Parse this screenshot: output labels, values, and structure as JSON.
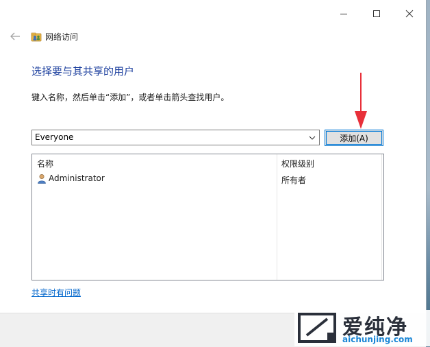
{
  "window": {
    "title": "网络访问"
  },
  "header": {
    "heading": "选择要与其共享的用户",
    "instruction": "键入名称，然后单击“添加”，或者单击箭头查找用户。"
  },
  "user_input": {
    "value": "Everyone"
  },
  "add_button": {
    "label": "添加(A)"
  },
  "table": {
    "columns": [
      "名称",
      "权限级别"
    ],
    "rows": [
      {
        "name": "Administrator",
        "permission": "所有者"
      }
    ]
  },
  "help_link": {
    "label": "共享时有问题"
  },
  "watermark": {
    "title": "爱纯净",
    "url": "aichunjing.com"
  },
  "colors": {
    "heading": "#1c3f9e",
    "link": "#0066cc",
    "accent": "#0078d7",
    "annotation_arrow": "#e8303a"
  },
  "icons": {
    "back": "arrow-left-icon",
    "app": "network-share-icon",
    "user": "user-icon",
    "dropdown": "chevron-down-icon",
    "minimize": "minimize-icon",
    "maximize": "maximize-icon",
    "close": "close-icon"
  }
}
